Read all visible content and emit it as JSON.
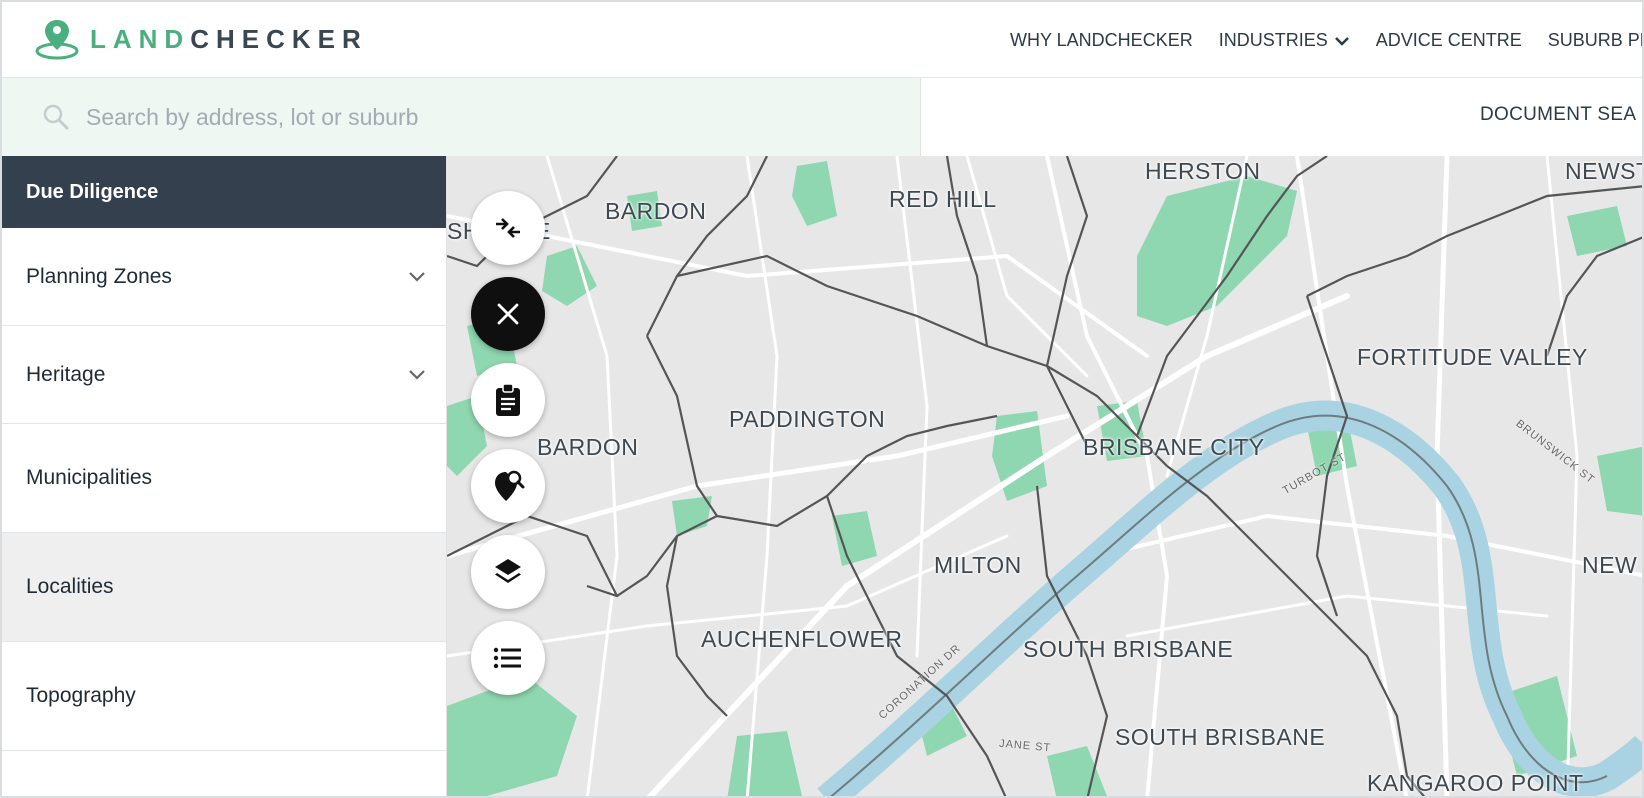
{
  "logo": {
    "part1": "LAND",
    "part2": "CHECKER"
  },
  "nav": {
    "items": [
      {
        "label": "WHY LANDCHECKER"
      },
      {
        "label": "INDUSTRIES",
        "has_dropdown": true
      },
      {
        "label": "ADVICE CENTRE"
      },
      {
        "label": "SUBURB PR"
      }
    ]
  },
  "search": {
    "placeholder": "Search by address, lot or suburb"
  },
  "document_search": "DOCUMENT SEA",
  "sidebar": {
    "header": "Due Diligence",
    "items": [
      {
        "label": "Planning Zones",
        "expandable": true
      },
      {
        "label": "Heritage",
        "expandable": true
      },
      {
        "label": "Municipalities"
      },
      {
        "label": "Localities",
        "active": true
      },
      {
        "label": "Topography"
      }
    ]
  },
  "map": {
    "suburbs": [
      "HERSTON",
      "NEWST",
      "RED HILL",
      "BARDON",
      "SH",
      "E",
      "PADDINGTON",
      "BARDON",
      "BRISBANE CITY",
      "FORTITUDE VALLEY",
      "MILTON",
      "NEW",
      "AUCHENFLOWER",
      "SOUTH BRISBANE",
      "SOUTH BRISBANE",
      "KANGAROO POINT"
    ],
    "streets": [
      "CORONATION DR",
      "TURBOT ST",
      "BRUNSWICK ST",
      "JANE ST"
    ]
  },
  "colors": {
    "accent": "#4aaf7e",
    "sidebar_header": "#34404d",
    "search_bg": "#eef7f2",
    "map_bg": "#e7e7e7",
    "park": "#8fd7b0",
    "water": "#a9d3e2",
    "boundary": "#555555"
  },
  "map_controls": [
    "collapse-icon",
    "close-icon",
    "clipboard-icon",
    "location-search-icon",
    "layers-icon",
    "list-icon"
  ]
}
